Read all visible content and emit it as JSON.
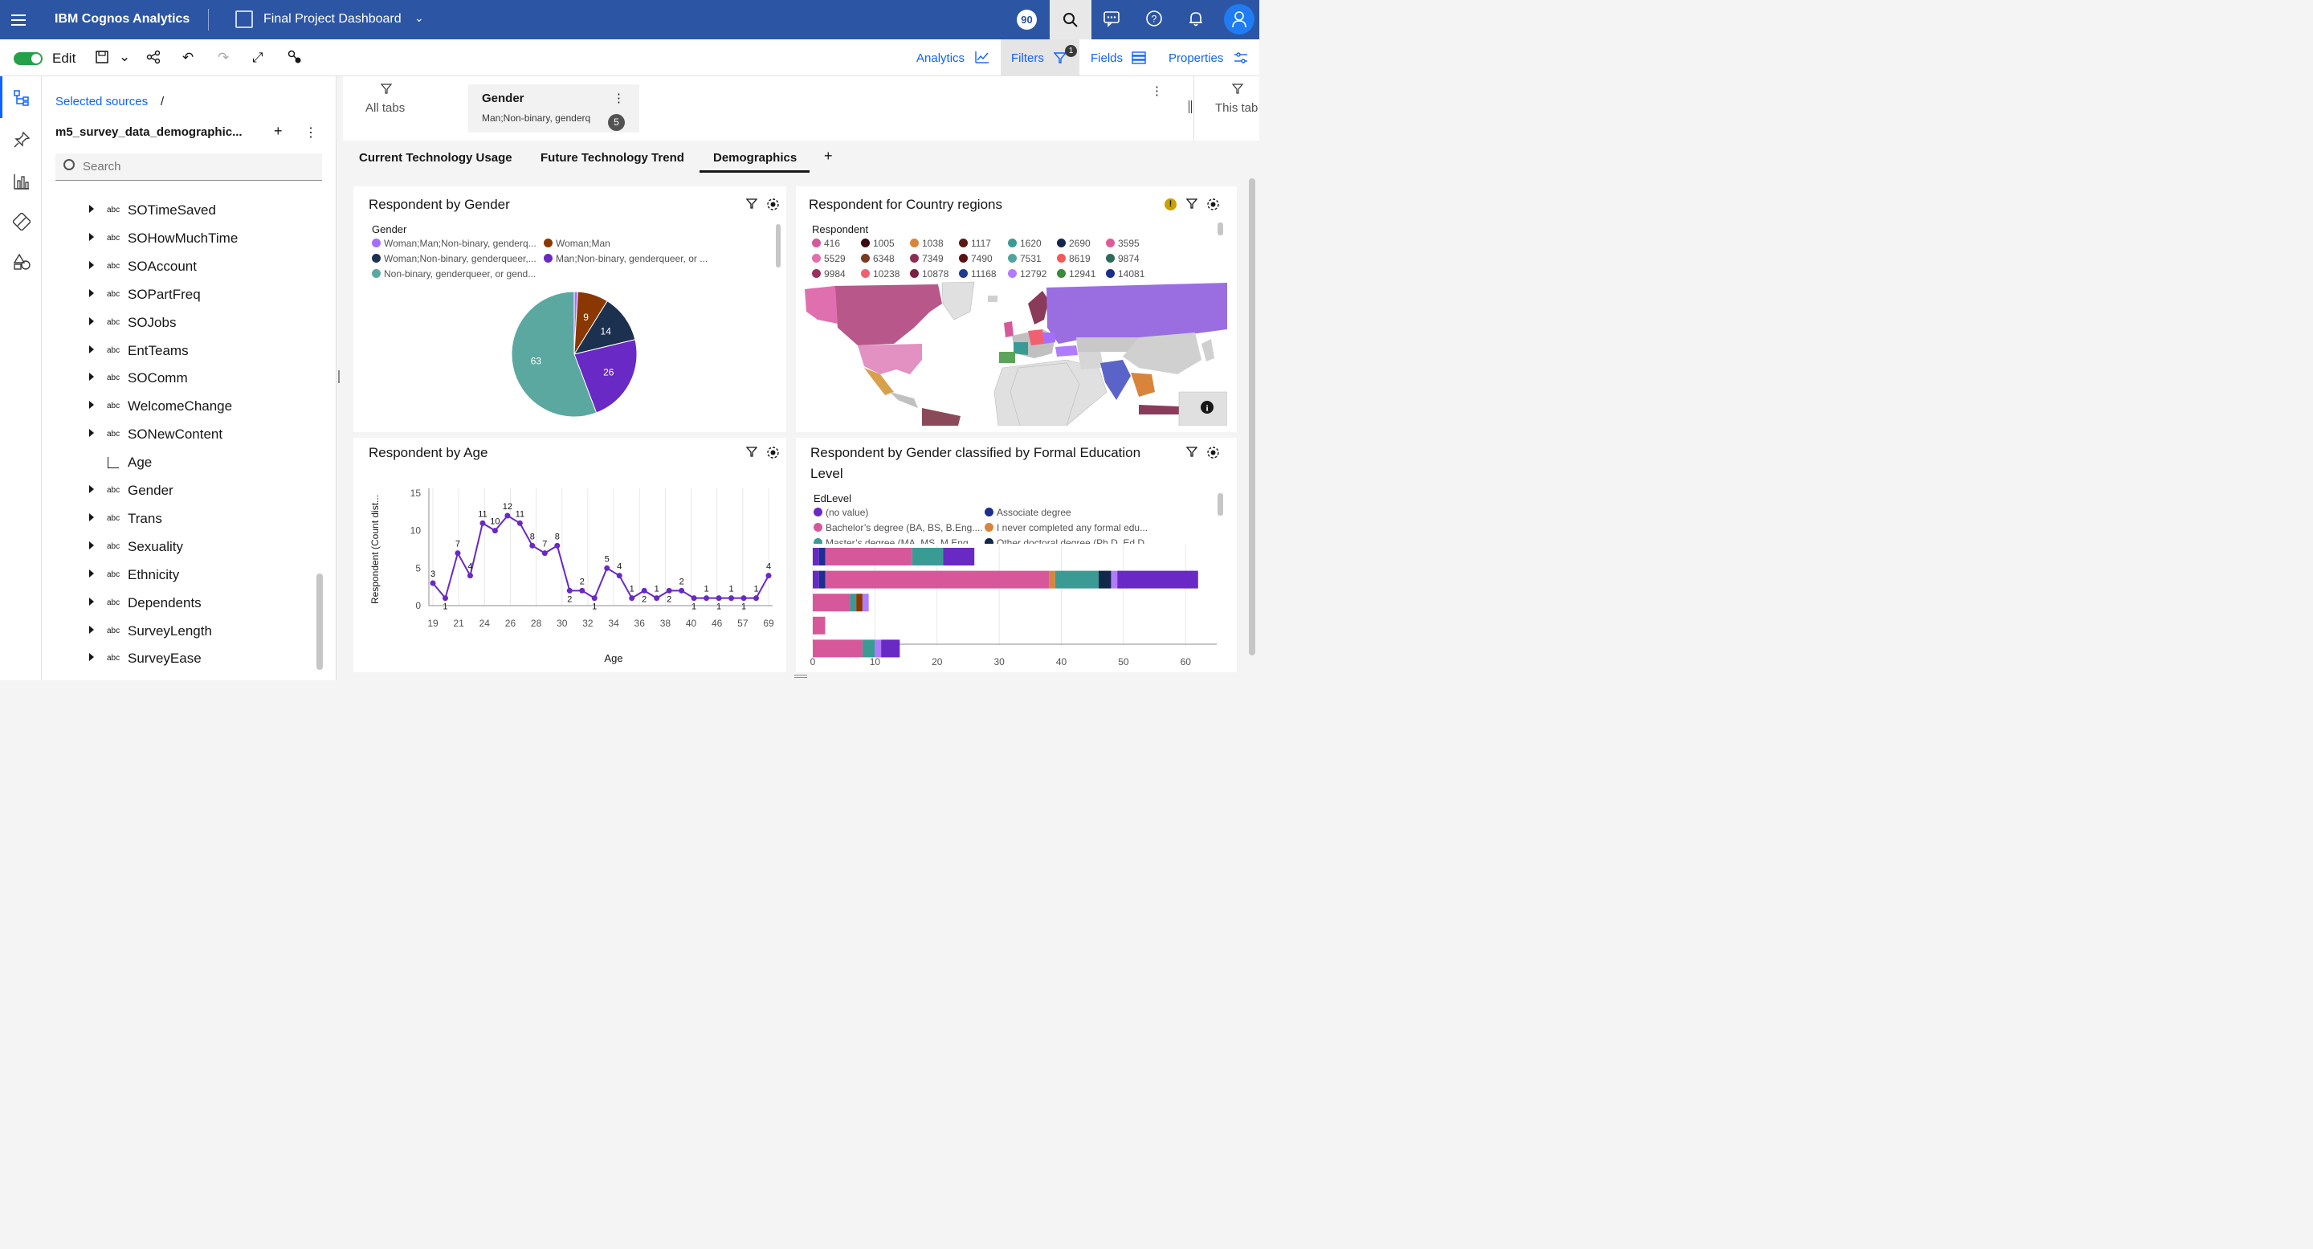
{
  "topbar": {
    "app_name": "IBM Cognos Analytics",
    "dashboard_title": "Final Project Dashboard",
    "notification_count": "90"
  },
  "toolbar": {
    "edit_label": "Edit",
    "analytics_label": "Analytics",
    "filters_label": "Filters",
    "filters_count": "1",
    "fields_label": "Fields",
    "properties_label": "Properties"
  },
  "panel": {
    "breadcrumb": "Selected sources",
    "breadcrumb_sep": "/",
    "source_name": "m5_survey_data_demographic...",
    "search_placeholder": "Search",
    "fields": [
      {
        "name": "SOTimeSaved",
        "type": "abc"
      },
      {
        "name": "SOHowMuchTime",
        "type": "abc"
      },
      {
        "name": "SOAccount",
        "type": "abc"
      },
      {
        "name": "SOPartFreq",
        "type": "abc"
      },
      {
        "name": "SOJobs",
        "type": "abc"
      },
      {
        "name": "EntTeams",
        "type": "abc"
      },
      {
        "name": "SOComm",
        "type": "abc"
      },
      {
        "name": "WelcomeChange",
        "type": "abc"
      },
      {
        "name": "SONewContent",
        "type": "abc"
      },
      {
        "name": "Age",
        "type": "measure"
      },
      {
        "name": "Gender",
        "type": "abc"
      },
      {
        "name": "Trans",
        "type": "abc"
      },
      {
        "name": "Sexuality",
        "type": "abc"
      },
      {
        "name": "Ethnicity",
        "type": "abc"
      },
      {
        "name": "Dependents",
        "type": "abc"
      },
      {
        "name": "SurveyLength",
        "type": "abc"
      },
      {
        "name": "SurveyEase",
        "type": "abc"
      }
    ]
  },
  "filterbar": {
    "all_tabs": "All tabs",
    "pill_title": "Gender",
    "pill_value": "Man;Non-binary, genderq",
    "pill_count": "5",
    "this_tab": "This tab"
  },
  "tabs": [
    "Current Technology Usage",
    "Future Technology Trend",
    "Demographics"
  ],
  "tab_add": "+",
  "cards": {
    "gender": {
      "title": "Respondent by Gender",
      "legend_title": "Gender",
      "legend": [
        {
          "label": "Woman;Man;Non-binary, genderq...",
          "color": "#a56eff"
        },
        {
          "label": "Woman;Man",
          "color": "#8a3800"
        },
        {
          "label": "Woman;Non-binary, genderqueer,...",
          "color": "#1c3050"
        },
        {
          "label": "Man;Non-binary, genderqueer, or ...",
          "color": "#6929c4"
        },
        {
          "label": "Non-binary, genderqueer, or gend...",
          "color": "#5ba8a0"
        }
      ]
    },
    "country": {
      "title": "Respondent for Country regions",
      "legend_title": "Respondent",
      "legend": [
        {
          "label": "416",
          "color": "#d6589b"
        },
        {
          "label": "1005",
          "color": "#3a0a14"
        },
        {
          "label": "1038",
          "color": "#d9843c"
        },
        {
          "label": "1117",
          "color": "#5a1a12"
        },
        {
          "label": "1620",
          "color": "#3a9b94"
        },
        {
          "label": "2690",
          "color": "#12284a"
        },
        {
          "label": "3595",
          "color": "#e05a9a"
        },
        {
          "label": "5529",
          "color": "#e06fb0"
        },
        {
          "label": "6348",
          "color": "#7a3a22"
        },
        {
          "label": "7349",
          "color": "#8a2e55"
        },
        {
          "label": "7490",
          "color": "#5a1018"
        },
        {
          "label": "7531",
          "color": "#4fa59b"
        },
        {
          "label": "8619",
          "color": "#f05a5a"
        },
        {
          "label": "9874",
          "color": "#2e6a5a"
        },
        {
          "label": "9984",
          "color": "#9a3060"
        },
        {
          "label": "10238",
          "color": "#f06070"
        },
        {
          "label": "10878",
          "color": "#7a2040"
        },
        {
          "label": "11168",
          "color": "#1f3a8f"
        },
        {
          "label": "12792",
          "color": "#b07cff"
        },
        {
          "label": "12941",
          "color": "#3a8a3a"
        },
        {
          "label": "14081",
          "color": "#1a2e8a"
        }
      ]
    },
    "age": {
      "title": "Respondent by Age"
    },
    "edu": {
      "title": "Respondent by Gender classified by Formal Education",
      "title2": "Level",
      "legend_title": "EdLevel",
      "legend": [
        {
          "label": "(no value)",
          "color": "#6929c4"
        },
        {
          "label": "Associate degree",
          "color": "#1c2e90"
        },
        {
          "label": "Bachelor’s degree (BA, BS, B.Eng....",
          "color": "#d6589b"
        },
        {
          "label": "I never completed any formal edu...",
          "color": "#d9843c"
        },
        {
          "label": "Master’s degree (MA, MS, M.Eng....",
          "color": "#3a9b94"
        },
        {
          "label": "Other doctoral degree (Ph.D, Ed.D...",
          "color": "#12284a"
        }
      ]
    }
  },
  "chart_data": [
    {
      "type": "pie",
      "title": "Respondent by Gender",
      "legend_title": "Gender",
      "categories": [
        "Woman;Man;Non-binary, genderq...",
        "Woman;Man",
        "Woman;Non-binary, genderqueer,...",
        "Man;Non-binary, genderqueer, or ...",
        "Non-binary, genderqueer, or gend..."
      ],
      "values": [
        1,
        9,
        14,
        26,
        63
      ],
      "colors": [
        "#a56eff",
        "#8a3800",
        "#1c3050",
        "#6929c4",
        "#5ba8a0"
      ]
    },
    {
      "type": "line",
      "title": "Respondent by Age",
      "xlabel": "Age",
      "ylabel": "Respondent (Count dist...",
      "x_ticks": [
        "19",
        "21",
        "24",
        "26",
        "28",
        "30",
        "32",
        "34",
        "36",
        "38",
        "40",
        "46",
        "57",
        "69"
      ],
      "values": [
        3,
        1,
        7,
        4,
        11,
        10,
        12,
        11,
        8,
        7,
        8,
        2,
        2,
        1,
        5,
        4,
        1,
        2,
        1,
        2,
        2,
        1,
        1,
        1,
        1,
        1,
        1,
        4
      ],
      "value_labels": [
        "3",
        "1",
        "7",
        "4",
        "11",
        "10",
        "12",
        "11",
        "8",
        "7",
        "8",
        "2",
        "2",
        "1",
        "5",
        "4",
        "1",
        "2",
        "1",
        "2",
        "2",
        "1",
        "1",
        "1",
        "1",
        "1",
        "1",
        "4"
      ],
      "y_ticks": [
        "0",
        "5",
        "10",
        "15"
      ],
      "ylim": [
        0,
        15
      ],
      "color": "#6929c4"
    },
    {
      "type": "bar",
      "orientation": "horizontal",
      "stacked": true,
      "title": "Respondent by Gender classified by Formal Education Level",
      "x_ticks": [
        "0",
        "10",
        "20",
        "30",
        "40",
        "50",
        "60"
      ],
      "xlim": [
        0,
        65
      ],
      "rows": [
        [
          {
            "v": 1,
            "c": "#6929c4"
          },
          {
            "v": 1,
            "c": "#1c2e90"
          },
          {
            "v": 14,
            "c": "#d6589b"
          },
          {
            "v": 5,
            "c": "#3a9b94"
          },
          {
            "v": 5,
            "c": "#6929c4"
          }
        ],
        [
          {
            "v": 1,
            "c": "#6929c4"
          },
          {
            "v": 1,
            "c": "#1c2e90"
          },
          {
            "v": 36,
            "c": "#d6589b"
          },
          {
            "v": 1,
            "c": "#d9843c"
          },
          {
            "v": 7,
            "c": "#3a9b94"
          },
          {
            "v": 2,
            "c": "#12284a"
          },
          {
            "v": 1,
            "c": "#b07cff"
          },
          {
            "v": 13,
            "c": "#6929c4"
          }
        ],
        [
          {
            "v": 6,
            "c": "#d6589b"
          },
          {
            "v": 1,
            "c": "#3a9b94"
          },
          {
            "v": 1,
            "c": "#8a3800"
          },
          {
            "v": 1,
            "c": "#b07cff"
          }
        ],
        [
          {
            "v": 2,
            "c": "#d6589b"
          }
        ],
        [
          {
            "v": 8,
            "c": "#d6589b"
          },
          {
            "v": 2,
            "c": "#3a9b94"
          },
          {
            "v": 1,
            "c": "#b07cff"
          },
          {
            "v": 3,
            "c": "#6929c4"
          }
        ]
      ]
    }
  ]
}
